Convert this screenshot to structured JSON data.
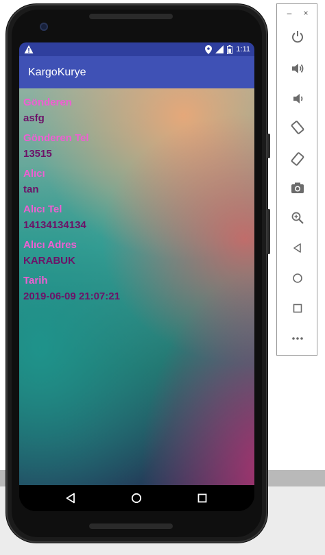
{
  "status_bar": {
    "time": "1:11",
    "warning_icon": "warning-icon",
    "location_icon": "location-icon",
    "signal_icon": "signal-icon",
    "battery_icon": "battery-icon"
  },
  "app_bar": {
    "title": "KargoKurye"
  },
  "fields": [
    {
      "label": "Gönderen",
      "value": "asfg"
    },
    {
      "label": "Gönderen Tel",
      "value": "13515"
    },
    {
      "label": "Alıcı",
      "value": "tan"
    },
    {
      "label": "Alıcı Tel",
      "value": "14134134134"
    },
    {
      "label": "Alıcı Adres",
      "value": "KARABUK"
    },
    {
      "label": "Tarih",
      "value": "2019-06-09 21:07:21"
    }
  ],
  "colors": {
    "status_bar": "#2f3f9e",
    "app_bar": "#3f51b5",
    "label": "#ee5fd2",
    "value": "#6d1268"
  },
  "nav_bar": [
    "back-icon",
    "home-icon",
    "recents-icon"
  ],
  "emulator_panel": {
    "window_controls": [
      "–",
      "×"
    ],
    "tools": [
      "power-icon",
      "volume-up-icon",
      "volume-down-icon",
      "rotate-left-icon",
      "rotate-right-icon",
      "camera-icon",
      "zoom-icon",
      "back-icon",
      "home-icon",
      "overview-icon",
      "more-icon"
    ]
  }
}
